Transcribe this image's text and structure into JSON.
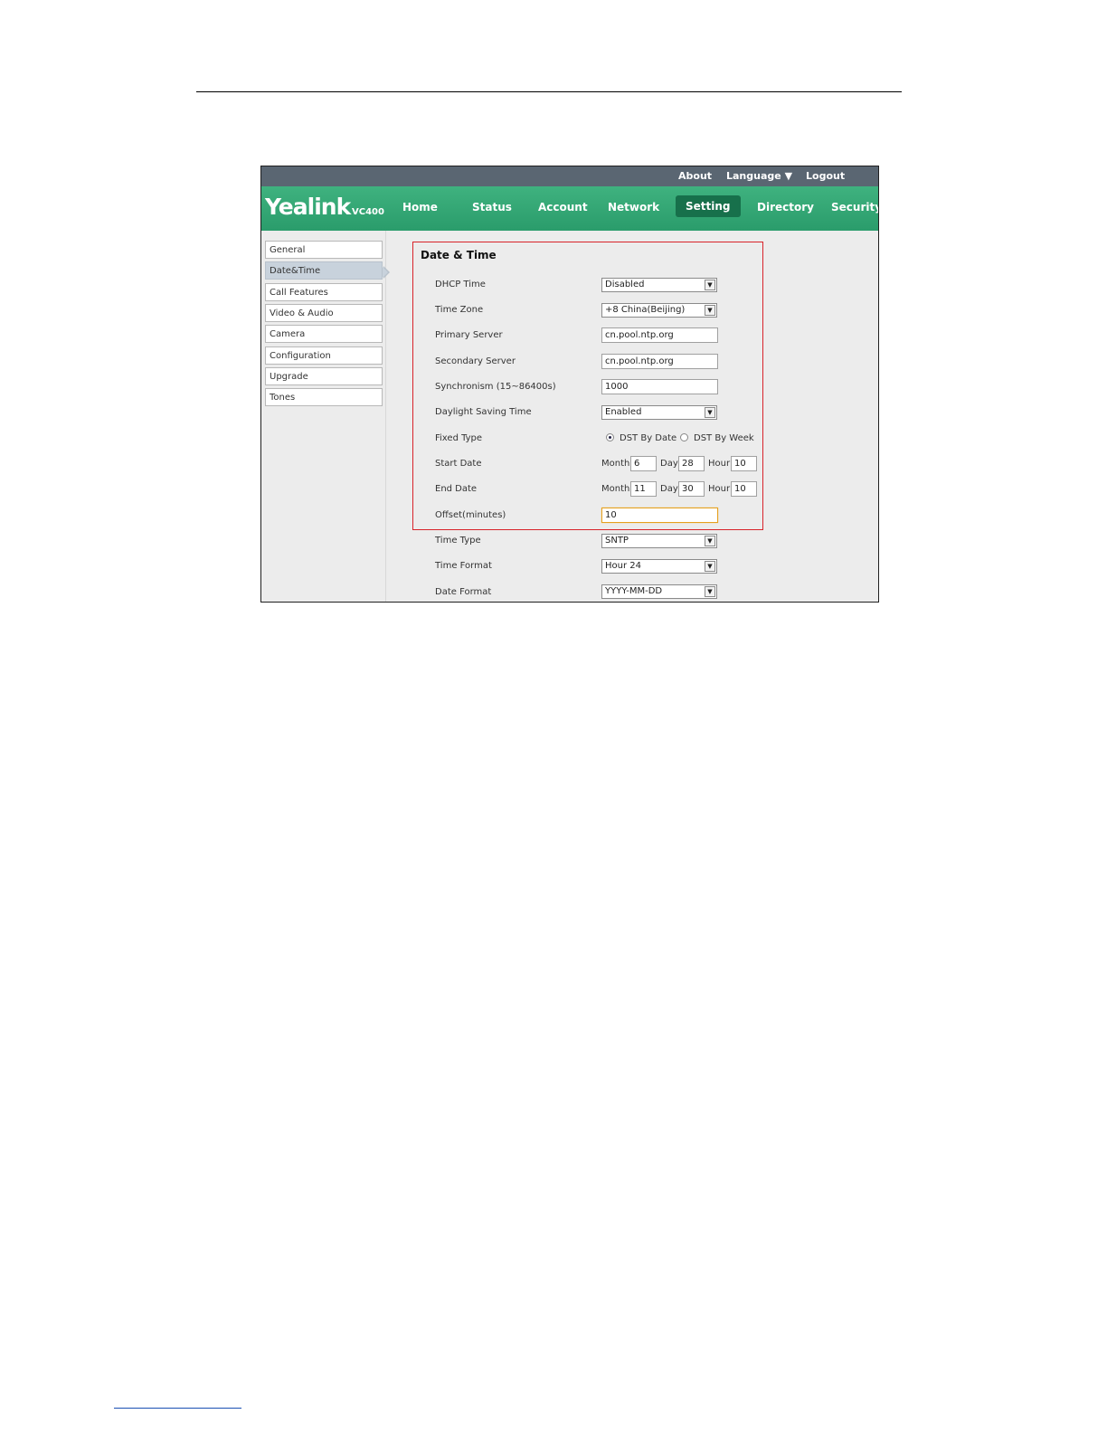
{
  "topbar": {
    "about": "About",
    "language": "Language",
    "logout": "Logout"
  },
  "brand": {
    "logo": "Yealink",
    "model": "VC400"
  },
  "nav": [
    {
      "label": "Home"
    },
    {
      "label": "Status"
    },
    {
      "label": "Account"
    },
    {
      "label": "Network"
    },
    {
      "label": "Setting",
      "active": true
    },
    {
      "label": "Directory"
    },
    {
      "label": "Security"
    }
  ],
  "sidebar": [
    {
      "label": "General"
    },
    {
      "label": "Date&Time",
      "active": true
    },
    {
      "label": "Call Features"
    },
    {
      "label": "Video & Audio"
    },
    {
      "label": "Camera"
    },
    {
      "label": "Configuration"
    },
    {
      "label": "Upgrade"
    },
    {
      "label": "Tones"
    }
  ],
  "section": {
    "title": "Date & Time"
  },
  "form": {
    "dhcp_time": {
      "label": "DHCP Time",
      "value": "Disabled"
    },
    "time_zone": {
      "label": "Time Zone",
      "value": "+8 China(Beijing)"
    },
    "primary_server": {
      "label": "Primary Server",
      "value": "cn.pool.ntp.org"
    },
    "secondary_server": {
      "label": "Secondary Server",
      "value": "cn.pool.ntp.org"
    },
    "synchronism": {
      "label": "Synchronism (15~86400s)",
      "value": "1000"
    },
    "daylight_saving": {
      "label": "Daylight Saving Time",
      "value": "Enabled"
    },
    "fixed_type": {
      "label": "Fixed Type",
      "option_date": "DST By Date",
      "option_week": "DST By Week",
      "selected": "DST By Date"
    },
    "start_date": {
      "label": "Start Date",
      "month_label": "Month",
      "month": "6",
      "day_label": "Day",
      "day": "28",
      "hour_label": "Hour",
      "hour": "10"
    },
    "end_date": {
      "label": "End Date",
      "month_label": "Month",
      "month": "11",
      "day_label": "Day",
      "day": "30",
      "hour_label": "Hour",
      "hour": "10"
    },
    "offset": {
      "label": "Offset(minutes)",
      "value": "10"
    },
    "time_type": {
      "label": "Time Type",
      "value": "SNTP"
    },
    "time_format": {
      "label": "Time Format",
      "value": "Hour 24"
    },
    "date_format": {
      "label": "Date Format",
      "value": "YYYY-MM-DD"
    }
  },
  "colors": {
    "nav_green": "#2fa572",
    "active_green": "#17704b",
    "topbar": "#5a6672",
    "highlight": "#d8232a"
  }
}
